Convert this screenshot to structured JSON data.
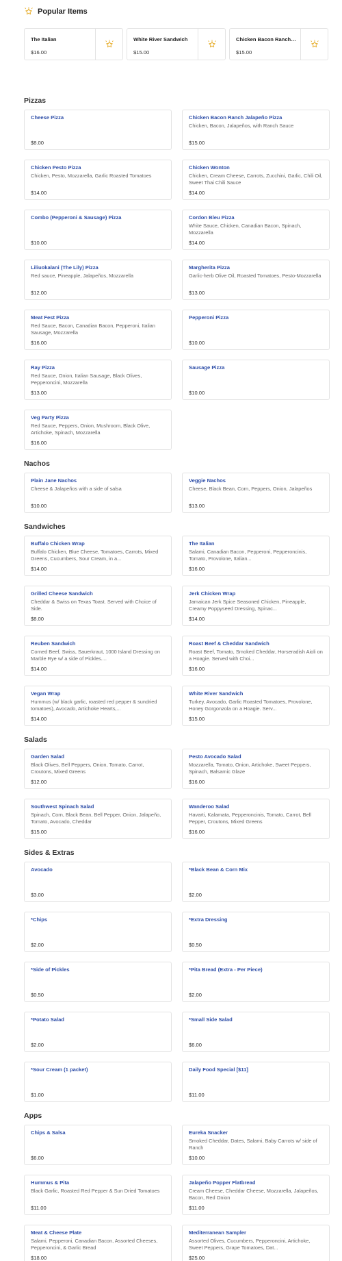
{
  "popular": {
    "title": "Popular Items",
    "items": [
      {
        "name": "The Italian",
        "price": "$16.00"
      },
      {
        "name": "White River Sandwich",
        "price": "$15.00"
      },
      {
        "name": "Chicken Bacon Ranch Jalapeño Pizza",
        "price": "$15.00"
      }
    ]
  },
  "sections": [
    {
      "title": "Pizzas",
      "items": [
        {
          "name": "Cheese Pizza",
          "desc": "",
          "price": "$8.00"
        },
        {
          "name": "Chicken Bacon Ranch Jalapeño Pizza",
          "desc": "Chicken, Bacon, Jalapeños, with Ranch Sauce",
          "price": "$15.00"
        },
        {
          "name": "Chicken Pesto Pizza",
          "desc": "Chicken, Pesto, Mozzarella, Garlic Roasted Tomatoes",
          "price": "$14.00"
        },
        {
          "name": "Chicken Wonton",
          "desc": "Chicken, Cream Cheese, Carrots, Zucchini, Garlic, Chili Oil, Sweet Thai Chili Sauce",
          "price": "$14.00"
        },
        {
          "name": "Combo (Pepperoni & Sausage) Pizza",
          "desc": "",
          "price": "$10.00"
        },
        {
          "name": "Cordon Bleu Pizza",
          "desc": "White Sauce, Chicken, Canadian Bacon, Spinach, Mozzarella",
          "price": "$14.00"
        },
        {
          "name": "Liliuokalani (The Lily) Pizza",
          "desc": "Red sauce, Pineapple, Jalapeños, Mozzarella",
          "price": "$12.00"
        },
        {
          "name": "Margherita Pizza",
          "desc": "Garlic-herb Olive Oil, Roasted Tomatoes, Pesto-Mozzarella",
          "price": "$13.00"
        },
        {
          "name": "Meat Fest Pizza",
          "desc": "Red Sauce, Bacon, Canadian Bacon, Pepperoni, Italian Sausage, Mozzarella",
          "price": "$16.00"
        },
        {
          "name": "Pepperoni Pizza",
          "desc": "",
          "price": "$10.00"
        },
        {
          "name": "Ray Pizza",
          "desc": "Red Sauce, Onion, Italian Sausage, Black Olives, Pepperoncini, Mozzarella",
          "price": "$13.00"
        },
        {
          "name": "Sausage Pizza",
          "desc": "",
          "price": "$10.00"
        },
        {
          "name": "Veg Party Pizza",
          "desc": "Red Sauce, Peppers, Onion, Mushroom, Black Olive, Artichoke, Spinach, Mozzarella",
          "price": "$16.00"
        }
      ]
    },
    {
      "title": "Nachos",
      "items": [
        {
          "name": "Plain Jane Nachos",
          "desc": "Cheese & Jalapeños with a side of salsa",
          "price": "$10.00"
        },
        {
          "name": "Veggie Nachos",
          "desc": "Cheese, Black Bean, Corn, Peppers, Onion, Jalapeños",
          "price": "$13.00"
        }
      ]
    },
    {
      "title": "Sandwiches",
      "items": [
        {
          "name": "Buffalo Chicken Wrap",
          "desc": "Buffalo Chicken, Blue Cheese, Tomatoes, Carrots, Mixed Greens, Cucumbers, Sour Cream, in a...",
          "price": "$14.00"
        },
        {
          "name": "The Italian",
          "desc": "Salami, Canadian Bacon, Pepperoni, Pepperoncinis, Tomato, Provolone, Italian...",
          "price": "$16.00"
        },
        {
          "name": "Grilled Cheese Sandwich",
          "desc": "Cheddar & Swiss on Texas Toast. Served with Choice of Side.",
          "price": "$8.00"
        },
        {
          "name": "Jerk Chicken Wrap",
          "desc": "Jamaican Jerk Spice Seasoned Chicken, Pineapple, Creamy Poppyseed Dressing, Spinac...",
          "price": "$14.00"
        },
        {
          "name": "Reuben Sandwich",
          "desc": "Corned Beef, Swiss, Sauerkraut, 1000 Island Dressing on Marble Rye w/ a side of Pickles....",
          "price": "$14.00"
        },
        {
          "name": "Roast Beef & Cheddar Sandwich",
          "desc": "Roast Beef, Tomato, Smoked Cheddar, Horseradish Aioli on a Hoagie. Served with Choi...",
          "price": "$16.00"
        },
        {
          "name": "Vegan Wrap",
          "desc": "Hummus (w/ black garlic, roasted red pepper & sundried tomatoes), Avocado, Artichoke Hearts,...",
          "price": "$14.00"
        },
        {
          "name": "White River Sandwich",
          "desc": "Turkey, Avocado, Garlic Roasted Tomatoes, Provolone, Honey Gorgonzola on a Hoagie. Serv...",
          "price": "$15.00"
        }
      ]
    },
    {
      "title": "Salads",
      "items": [
        {
          "name": "Garden Salad",
          "desc": "Black Olives, Bell Peppers, Onion, Tomato, Carrot, Croutons, Mixed Greens",
          "price": "$12.00"
        },
        {
          "name": "Pesto Avocado Salad",
          "desc": "Mozzarella, Tomato, Onion, Artichoke, Sweet Peppers, Spinach, Balsamic Glaze",
          "price": "$16.00"
        },
        {
          "name": "Southwest Spinach Salad",
          "desc": "Spinach, Corn, Black Bean, Bell Pepper, Onion, Jalapeño, Tomato, Avocado, Cheddar",
          "price": "$15.00"
        },
        {
          "name": "Wanderoo Salad",
          "desc": "Havarti, Kalamata, Pepperoncinis, Tomato, Carrot, Bell Pepper, Croutons, Mixed Greens",
          "price": "$16.00"
        }
      ]
    },
    {
      "title": "Sides & Extras",
      "items": [
        {
          "name": "Avocado",
          "desc": "",
          "price": "$3.00"
        },
        {
          "name": "*Black Bean & Corn Mix",
          "desc": "",
          "price": "$2.00"
        },
        {
          "name": "*Chips",
          "desc": "",
          "price": "$2.00"
        },
        {
          "name": "*Extra Dressing",
          "desc": "",
          "price": "$0.50"
        },
        {
          "name": "*Side of Pickles",
          "desc": "",
          "price": "$0.50"
        },
        {
          "name": "*Pita Bread (Extra - Per Piece)",
          "desc": "",
          "price": "$2.00"
        },
        {
          "name": "*Potato Salad",
          "desc": "",
          "price": "$2.00"
        },
        {
          "name": "*Small Side Salad",
          "desc": "",
          "price": "$6.00"
        },
        {
          "name": "*Sour Cream (1 packet)",
          "desc": "",
          "price": "$1.00"
        },
        {
          "name": "Daily Food Special [$11]",
          "desc": "",
          "price": "$11.00"
        }
      ]
    },
    {
      "title": "Apps",
      "items": [
        {
          "name": "Chips & Salsa",
          "desc": "",
          "price": "$6.00"
        },
        {
          "name": "Eureka Snacker",
          "desc": "Smoked Cheddar, Dates, Salami, Baby Carrots w/ side of Ranch",
          "price": "$10.00"
        },
        {
          "name": "Hummus & Pita",
          "desc": "Black Garlic, Roasted Red Pepper & Sun Dried Tomatoes",
          "price": "$11.00"
        },
        {
          "name": "Jalapeño Popper Flatbread",
          "desc": "Cream Cheese, Cheddar Cheese, Mozzarella, Jalapeños, Bacon, Red Onion",
          "price": "$11.00"
        },
        {
          "name": "Meat & Cheese Plate",
          "desc": "Salami, Pepperoni, Canadian Bacon, Assorted Cheeses, Pepperoncini, & Garlic Bread",
          "price": "$18.00"
        },
        {
          "name": "Mediterranean Sampler",
          "desc": "Assorted Olives, Cucumbers, Pepperoncini, Artichoke, Sweet Peppers, Grape Tomatoes, Dat...",
          "price": "$25.00"
        }
      ]
    }
  ],
  "colors": {
    "accent": "#2f4fa8",
    "star": "#e8b33a",
    "border": "#e3e3e3"
  }
}
